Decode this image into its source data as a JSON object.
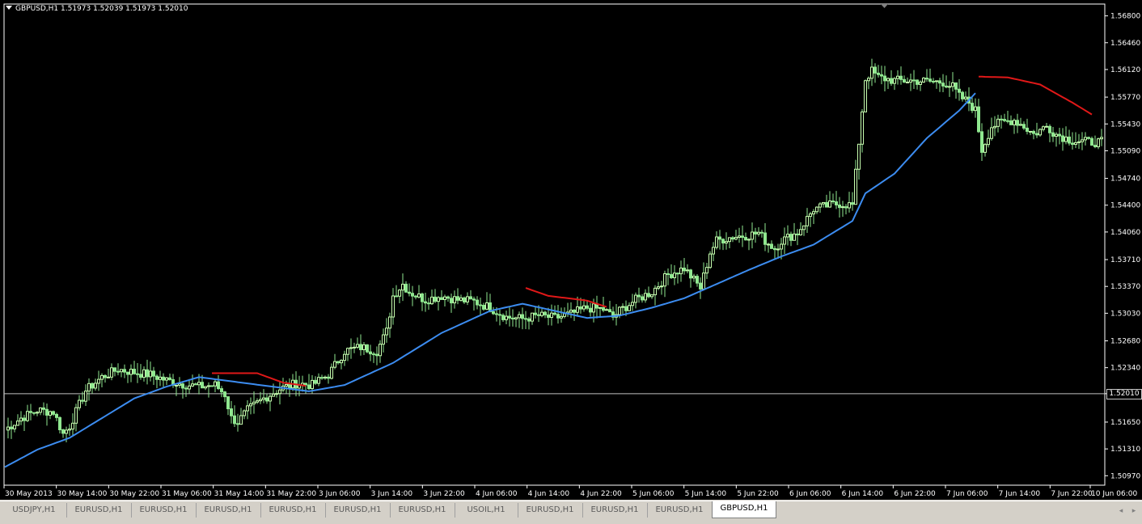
{
  "window": {
    "symbol_line": "GBPUSD,H1  1.51973 1.52039 1.51973 1.52010",
    "current_price_label": "1.52010"
  },
  "colors": {
    "background": "#000000",
    "axis": "#ffffff",
    "bull_candle": "#c8ffb0",
    "bear_candle": "#90e890",
    "ma_blue": "#3c8cf0",
    "ma_red": "#e01818",
    "current_price_line": "#c0c0c0"
  },
  "chart_data": {
    "type": "candlestick",
    "symbol": "GBPUSD",
    "timeframe": "H1",
    "y_ticks": [
      "1.56800",
      "1.56460",
      "1.56120",
      "1.55770",
      "1.55430",
      "1.55090",
      "1.54740",
      "1.54400",
      "1.54060",
      "1.53710",
      "1.53370",
      "1.53030",
      "1.52680",
      "1.52340",
      "1.52010",
      "1.51650",
      "1.51310",
      "1.50970"
    ],
    "ylim": [
      1.5085,
      1.5695
    ],
    "current_price": 1.5201,
    "x_labels": [
      "30 May 2013",
      "30 May 14:00",
      "30 May 22:00",
      "31 May 06:00",
      "31 May 14:00",
      "31 May 22:00",
      "3 Jun 06:00",
      "3 Jun 14:00",
      "3 Jun 22:00",
      "4 Jun 06:00",
      "4 Jun 14:00",
      "4 Jun 22:00",
      "5 Jun 06:00",
      "5 Jun 14:00",
      "5 Jun 22:00",
      "6 Jun 06:00",
      "6 Jun 14:00",
      "6 Jun 22:00",
      "7 Jun 06:00",
      "7 Jun 14:00",
      "7 Jun 22:00",
      "10 Jun 06:00"
    ],
    "bar_count": 170,
    "close_path_anchors": [
      [
        0,
        1.5155
      ],
      [
        5,
        1.517
      ],
      [
        10,
        1.518
      ],
      [
        15,
        1.5178
      ],
      [
        18,
        1.515
      ],
      [
        20,
        1.516
      ],
      [
        25,
        1.5205
      ],
      [
        30,
        1.5222
      ],
      [
        35,
        1.5232
      ],
      [
        40,
        1.5228
      ],
      [
        45,
        1.5225
      ],
      [
        50,
        1.5218
      ],
      [
        55,
        1.5213
      ],
      [
        60,
        1.521
      ],
      [
        65,
        1.5212
      ],
      [
        68,
        1.52
      ],
      [
        70,
        1.517
      ],
      [
        72,
        1.5165
      ],
      [
        75,
        1.518
      ],
      [
        80,
        1.5195
      ],
      [
        85,
        1.5207
      ],
      [
        90,
        1.5214
      ],
      [
        95,
        1.5212
      ],
      [
        100,
        1.5225
      ],
      [
        105,
        1.5255
      ],
      [
        110,
        1.526
      ],
      [
        115,
        1.5255
      ],
      [
        118,
        1.528
      ],
      [
        120,
        1.5325
      ],
      [
        123,
        1.534
      ],
      [
        125,
        1.533
      ],
      [
        130,
        1.532
      ],
      [
        135,
        1.5325
      ],
      [
        140,
        1.532
      ],
      [
        145,
        1.5318
      ],
      [
        150,
        1.531
      ],
      [
        155,
        1.5298
      ],
      [
        160,
        1.5296
      ],
      [
        165,
        1.53
      ],
      [
        170,
        1.5297
      ],
      [
        175,
        1.5302
      ],
      [
        180,
        1.531
      ],
      [
        185,
        1.5308
      ],
      [
        188,
        1.5298
      ],
      [
        190,
        1.5306
      ],
      [
        195,
        1.532
      ],
      [
        200,
        1.533
      ],
      [
        205,
        1.5352
      ],
      [
        210,
        1.536
      ],
      [
        212,
        1.535
      ],
      [
        215,
        1.5335
      ],
      [
        218,
        1.538
      ],
      [
        220,
        1.5395
      ],
      [
        225,
        1.54
      ],
      [
        230,
        1.5402
      ],
      [
        233,
        1.5405
      ],
      [
        235,
        1.5395
      ],
      [
        238,
        1.5385
      ],
      [
        240,
        1.5395
      ],
      [
        245,
        1.5405
      ],
      [
        250,
        1.5435
      ],
      [
        255,
        1.544
      ],
      [
        258,
        1.5442
      ],
      [
        262,
        1.544
      ],
      [
        264,
        1.552
      ],
      [
        266,
        1.56
      ],
      [
        268,
        1.561
      ],
      [
        270,
        1.5602
      ],
      [
        275,
        1.5598
      ],
      [
        280,
        1.5598
      ],
      [
        285,
        1.5597
      ],
      [
        290,
        1.5596
      ],
      [
        293,
        1.559
      ],
      [
        295,
        1.5578
      ],
      [
        298,
        1.557
      ],
      [
        300,
        1.556
      ],
      [
        302,
        1.551
      ],
      [
        305,
        1.554
      ],
      [
        308,
        1.5545
      ],
      [
        312,
        1.5548
      ],
      [
        315,
        1.554
      ],
      [
        318,
        1.553
      ],
      [
        320,
        1.5535
      ],
      [
        322,
        1.554
      ],
      [
        325,
        1.553
      ],
      [
        328,
        1.5525
      ],
      [
        330,
        1.5522
      ],
      [
        335,
        1.552
      ]
    ],
    "ma_blue_anchors": [
      [
        0,
        1.5108
      ],
      [
        10,
        1.513
      ],
      [
        20,
        1.5145
      ],
      [
        30,
        1.517
      ],
      [
        40,
        1.5195
      ],
      [
        50,
        1.521
      ],
      [
        60,
        1.5222
      ],
      [
        94,
        1.5204
      ],
      [
        105,
        1.5212
      ],
      [
        120,
        1.524
      ],
      [
        135,
        1.5278
      ],
      [
        150,
        1.5306
      ],
      [
        160,
        1.5315
      ],
      [
        180,
        1.5297
      ],
      [
        190,
        1.53
      ],
      [
        200,
        1.531
      ],
      [
        210,
        1.5322
      ],
      [
        220,
        1.534
      ],
      [
        230,
        1.5358
      ],
      [
        240,
        1.5375
      ],
      [
        250,
        1.539
      ],
      [
        258,
        1.541
      ],
      [
        262,
        1.542
      ],
      [
        266,
        1.5455
      ],
      [
        275,
        1.548
      ],
      [
        285,
        1.5525
      ],
      [
        295,
        1.556
      ],
      [
        300,
        1.5582
      ]
    ],
    "ma_red_segments": [
      [
        [
          64,
          1.5227
        ],
        [
          78,
          1.5227
        ],
        [
          86,
          1.5215
        ],
        [
          93,
          1.5211
        ]
      ],
      [
        [
          161,
          1.5335
        ],
        [
          168,
          1.5325
        ],
        [
          180,
          1.5319
        ],
        [
          186,
          1.5311
        ]
      ],
      [
        [
          301,
          1.5603
        ],
        [
          310,
          1.5602
        ],
        [
          320,
          1.5593
        ],
        [
          330,
          1.557
        ],
        [
          336,
          1.5555
        ]
      ]
    ]
  },
  "tabs": [
    {
      "label": "USDJPY,H1",
      "active": false
    },
    {
      "label": "EURUSD,H1",
      "active": false
    },
    {
      "label": "EURUSD,H1",
      "active": false
    },
    {
      "label": "EURUSD,H1",
      "active": false
    },
    {
      "label": "EURUSD,H1",
      "active": false
    },
    {
      "label": "EURUSD,H1",
      "active": false
    },
    {
      "label": "EURUSD,H1",
      "active": false
    },
    {
      "label": "USOIL,H1",
      "active": false
    },
    {
      "label": "EURUSD,H1",
      "active": false
    },
    {
      "label": "EURUSD,H1",
      "active": false
    },
    {
      "label": "EURUSD,H1",
      "active": false
    },
    {
      "label": "GBPUSD,H1",
      "active": true
    }
  ],
  "tab_scroll": {
    "left": "◂",
    "right": "▸"
  }
}
